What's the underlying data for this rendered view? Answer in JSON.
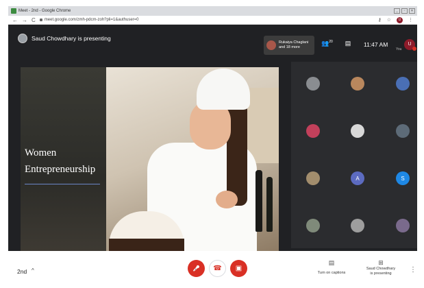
{
  "browser": {
    "tab_title": "Meet - 2nd - Google Chrome",
    "url": "meet.google.com/zmh-pdcm-zoh?pli=1&authuser=0",
    "nav": {
      "back": "←",
      "forward": "→",
      "reload": "C"
    },
    "window_controls": [
      "_",
      "▫",
      "✕"
    ],
    "profile_initial": "U",
    "icons": {
      "key": "⚷",
      "star": "☆",
      "menu": "⋮"
    }
  },
  "meet": {
    "presenting_text": "Saud Chowdhary is presenting",
    "pip": {
      "line1": "Rukaiya Chaglani",
      "line2": "and 18 more"
    },
    "participants_icon": "👥",
    "participants_count": "20",
    "chat_icon": "▤",
    "time": "11:47 AM",
    "you_label": "You",
    "user_initial": "U"
  },
  "slide": {
    "title_line1": "Women",
    "title_line2": "Entrepreneurship"
  },
  "grid": {
    "tiles": [
      {
        "label": "",
        "color": "#8a8d91"
      },
      {
        "label": "",
        "color": "#b9875d"
      },
      {
        "label": "",
        "color": "#4a6fb5"
      },
      {
        "label": "",
        "color": "#c2405b"
      },
      {
        "label": "",
        "color": "#d8d8d8"
      },
      {
        "label": "",
        "color": "#5d6b78"
      },
      {
        "label": "",
        "color": "#a28d6d"
      },
      {
        "label": "A",
        "color": "#5c6bc0"
      },
      {
        "label": "S",
        "color": "#1e88e5"
      },
      {
        "label": "",
        "color": "#7f8a7a"
      },
      {
        "label": "",
        "color": "#9e9e9e"
      },
      {
        "label": "",
        "color": "#7a6a8c"
      }
    ]
  },
  "bottom": {
    "meeting_name": "2nd",
    "chevron": "^",
    "mic_icon": "🎤",
    "hangup_icon": "☎",
    "camera_icon": "▣",
    "captions_icon": "▤",
    "captions_label": "Turn on captions",
    "present_icon": "⊞",
    "present_line1": "Saud Chowdhary",
    "present_line2": "is presenting",
    "more_icon": "⋮"
  }
}
